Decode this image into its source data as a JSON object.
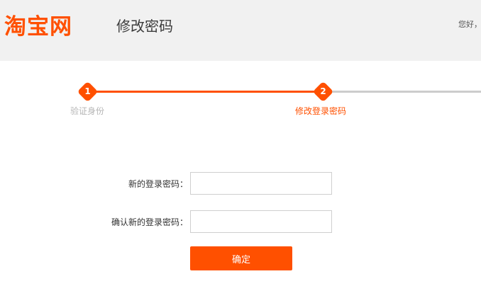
{
  "header": {
    "logo_text": "淘宝网",
    "title": "修改密码",
    "greeting": "您好，"
  },
  "steps": [
    {
      "number": "1",
      "label": "验证身份",
      "state": "done"
    },
    {
      "number": "2",
      "label": "修改登录密码",
      "state": "current"
    }
  ],
  "form": {
    "new_password_label": "新的登录密码：",
    "confirm_password_label": "确认新的登录密码：",
    "new_password_value": "",
    "confirm_password_value": "",
    "submit_label": "确定"
  },
  "colors": {
    "accent": "#ff5000",
    "step_done_label": "#b5b5b5",
    "inactive_line": "#cccccc",
    "header_bg": "#f1f1f1"
  }
}
